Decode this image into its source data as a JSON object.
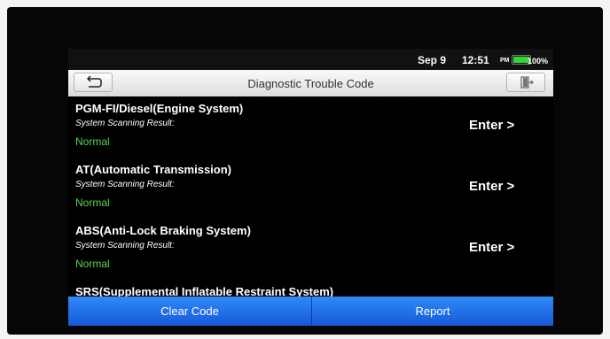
{
  "status_bar": {
    "date": "Sep 9",
    "time": "12:51",
    "ampm": "PM",
    "battery_percent": "100%",
    "battery_level": 1.0
  },
  "header": {
    "title": "Diagnostic Trouble Code",
    "back_icon": "back-arrow-icon",
    "exit_icon": "exit-door-icon"
  },
  "systems": [
    {
      "name": "PGM-FI/Diesel(Engine System)",
      "label": "System Scanning Result:",
      "result": "Normal",
      "action": "Enter >"
    },
    {
      "name": "AT(Automatic Transmission)",
      "label": "System Scanning Result:",
      "result": "Normal",
      "action": "Enter >"
    },
    {
      "name": "ABS(Anti-Lock Braking System)",
      "label": "System Scanning Result:",
      "result": "Normal",
      "action": "Enter >"
    },
    {
      "name": "SRS(Supplemental Inflatable Restraint System)"
    }
  ],
  "footer": {
    "clear_label": "Clear Code",
    "report_label": "Report"
  },
  "colors": {
    "result_normal": "#5ad452",
    "footer_blue": "#1f6fe8"
  }
}
